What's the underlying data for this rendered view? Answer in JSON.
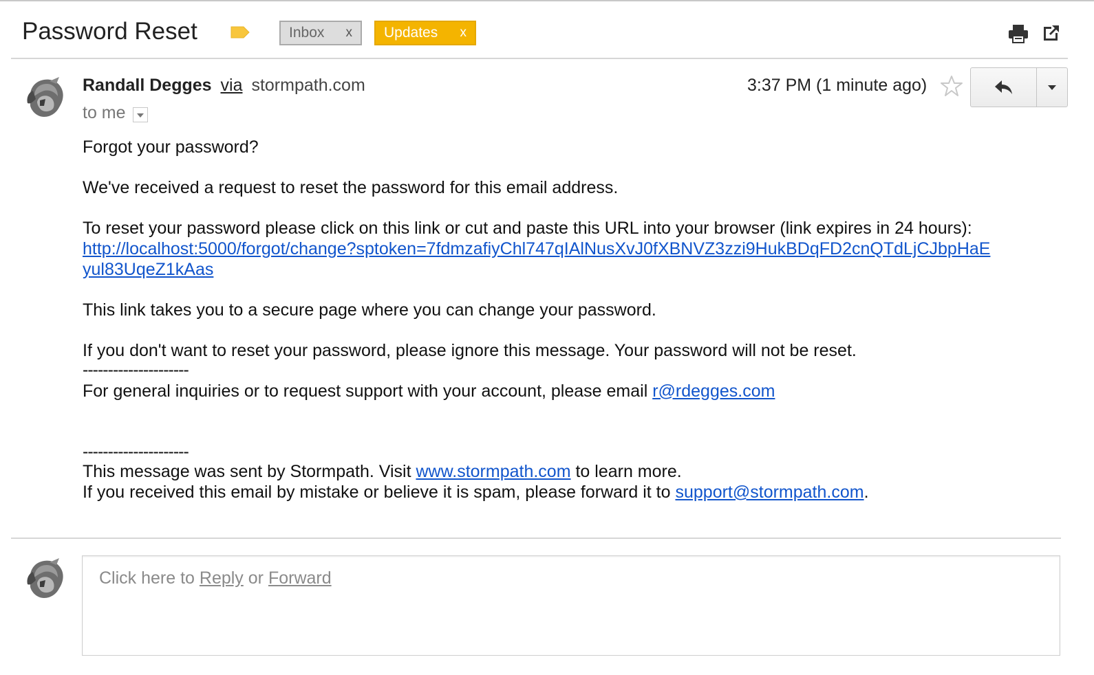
{
  "subject": {
    "title": "Password Reset",
    "labels": [
      {
        "name": "Inbox",
        "remove": "x",
        "color": "#dddddd"
      },
      {
        "name": "Updates",
        "remove": "x",
        "color": "#f4b400"
      }
    ],
    "icons": {
      "importance": "importance-marker-icon",
      "print": "print-icon",
      "new_window": "new-window-icon"
    }
  },
  "message": {
    "sender_name": "Randall Degges",
    "via": "via",
    "domain": "stormpath.com",
    "recipient": "to me",
    "timestamp": "3:37 PM (1 minute ago)",
    "icons": {
      "star": "star-icon",
      "reply": "reply-icon",
      "more": "chevron-down-icon"
    }
  },
  "body": {
    "greeting": "Forgot your password?",
    "received": "We've received a request to reset the password for this email address.",
    "instruction": "To reset your password please click on this link or cut and paste this URL into your browser (link expires in 24 hours):",
    "url_line_1": "http://localhost:5000/forgot/change?sptoken=7fdmzafiyChl747qIAlNusXvJ0fXBNVZ3zzi9HukBDqFD2cnQTdLjCJbpHaE",
    "url_line_2": "yul83UqeZ1kAas",
    "secure_page": "This link takes you to a secure page where you can change your password.",
    "ignore": "If you don't want to reset your password, please ignore this message. Your password will not be reset.",
    "divider": "---------------------",
    "support_text": "For general inquiries or to request support with your account, please email ",
    "support_email": "r@rdegges.com",
    "footer_text_1": "This message was sent by Stormpath. Visit ",
    "footer_link": "www.stormpath.com",
    "footer_text_2": " to learn more.",
    "spam_text": "If you received this email by mistake or believe it is spam, please forward it to ",
    "spam_email": "support@stormpath.com",
    "spam_end": "."
  },
  "reply_box": {
    "prefix": "Click here to ",
    "reply": "Reply",
    "or": " or ",
    "forward": "Forward"
  }
}
